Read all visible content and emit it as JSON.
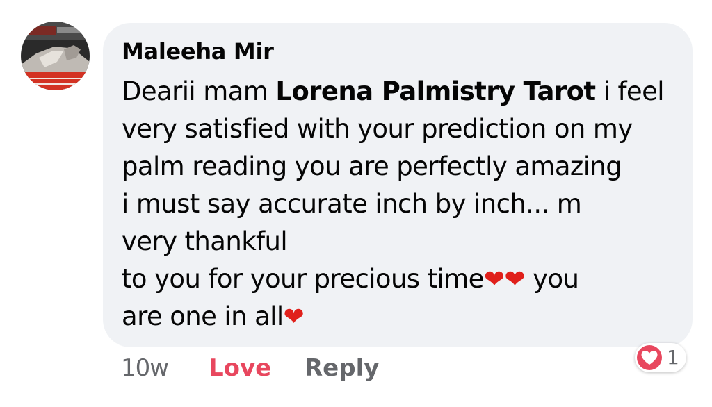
{
  "comment": {
    "author": "Maleeha Mir",
    "text_before_mention": "Dearii mam ",
    "mention": "Lorena Palmistry Tarot",
    "text_lines": [
      " i feel",
      "very satisfied with your prediction on my",
      "palm reading you are perfectly amazing",
      "i must say accurate inch by inch... m",
      "very thankful",
      "to you for your precious time",
      " you",
      "are one in all"
    ],
    "emoji": "❤"
  },
  "actions": {
    "time": "10w",
    "love": "Love",
    "reply": "Reply"
  },
  "reaction": {
    "icon": "heart-reaction-icon",
    "count": "1"
  },
  "colors": {
    "bubble": "#f0f2f5",
    "love": "#e8475e",
    "muted": "#65676b",
    "heart": "#e0201b"
  }
}
